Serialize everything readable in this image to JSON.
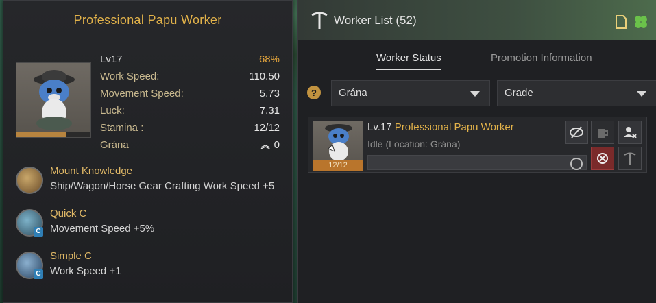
{
  "left_panel": {
    "title": "Professional Papu Worker",
    "stats": {
      "level": "Lv17",
      "exp_percent": "68%",
      "work_speed_label": "Work Speed:",
      "work_speed_value": "110.50",
      "movement_speed_label": "Movement Speed:",
      "movement_speed_value": "5.73",
      "luck_label": "Luck:",
      "luck_value": "7.31",
      "stamina_label": "Stamina   :",
      "stamina_value": "12/12",
      "town_label": "Grána",
      "grade_value": "0"
    },
    "stamina_fraction": 1.0,
    "skills": [
      {
        "name": "Mount Knowledge",
        "desc": "Ship/Wagon/Horse Gear Crafting Work Speed +5",
        "icon": "mount-knowledge-icon"
      },
      {
        "name": "Quick C",
        "desc": "Movement Speed +5%",
        "icon": "quick-c-icon",
        "badge": "C"
      },
      {
        "name": "Simple C",
        "desc": "Work Speed +1",
        "icon": "simple-c-icon",
        "badge": "C"
      }
    ]
  },
  "right_panel": {
    "title": "Worker List (52)",
    "tabs": [
      "Worker Status",
      "Promotion Information"
    ],
    "active_tab": "Worker Status",
    "filters": {
      "town": "Grána",
      "grade": "Grade"
    },
    "worker": {
      "level": "Lv.17",
      "name": "Professional Papu Worker",
      "location": "Idle (Location: Grána)",
      "stamina": "12/12"
    }
  },
  "colors": {
    "gold": "#e2b24a",
    "stamina_orange": "#b9752c"
  }
}
